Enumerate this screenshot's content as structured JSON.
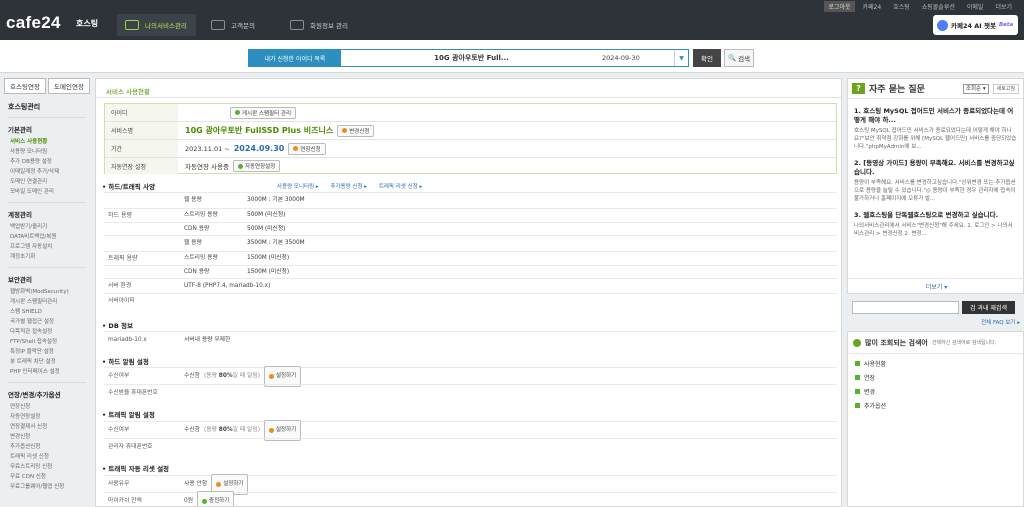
{
  "util": [
    "로그아웃",
    "카페24",
    "호스팅",
    "쇼핑몰솔루션",
    "이메일",
    "더보기"
  ],
  "logo": {
    "brand": "cafe24",
    "sub": "호스팅"
  },
  "nav": [
    {
      "label": "나의서비스관리",
      "active": true
    },
    {
      "label": "고객문의",
      "active": false
    },
    {
      "label": "회원정보 관리",
      "active": false
    }
  ],
  "ai": {
    "label": "카페24 AI 챗봇",
    "beta": "Beta"
  },
  "svc": {
    "label": "내가 신청한 아이디 목록",
    "name": "10G 광아우토반 Full...",
    "date": "2024-09-30",
    "ok": "확인",
    "search": "검색"
  },
  "left": {
    "tabs": [
      "호스팅연장",
      "도메인연장"
    ],
    "title": "호스팅관리",
    "sections": [
      {
        "h": "기본관리",
        "items": [
          "서비스 사용현황",
          "사용량 모니터링",
          "추가 DB용량 설정",
          "이메일계정 추가/삭제",
          "도메인 연결관리",
          "모바일 도메인 관리"
        ],
        "active": 0
      },
      {
        "h": "계정관리",
        "items": [
          "백업받기/올리기",
          "DATA비트백업/복원",
          "프로그램 자동설치",
          "계정초기화"
        ]
      },
      {
        "h": "보안관리",
        "items": [
          "웹방화벽(ModSecurity)",
          "게시판 스팸필터관리",
          "스팸 SHIELD",
          "국가별 웹접근 설정",
          "다목적관 접속설정",
          "FTP/Shell 접속설정",
          "특정IP 블락단 설정",
          "봇 트래픽 차단 설정",
          "PHP 인터페이스 설정"
        ]
      },
      {
        "h": "연장/변경/추가옵션",
        "items": [
          "연장신청",
          "자동연장설정",
          "연장결제서 신청",
          "변경신청",
          "추가옵션신청",
          "트래픽 리셋 신청",
          "무료스트리밍 신청",
          "무료 CDN 신청",
          "무료그룹웨어/웹앱 신청"
        ]
      }
    ]
  },
  "main": {
    "title": "서비스 사용현황",
    "info": {
      "id_label": "아이디",
      "id_btn": "게시판 스팸필터 관리",
      "svc_label": "서비스명",
      "svc_name": "10G 광아우토반 FullSSD Plus 비즈니스",
      "svc_btn": "변경신청",
      "period_label": "기간",
      "period_start": "2023.11.01 ~",
      "period_end": "2024.09.30",
      "period_btn": "연장신청",
      "auto_label": "자동연장 설정",
      "auto_val": "자동연장 사용중",
      "auto_btn": "자동연장설정"
    },
    "usage": {
      "title": "하드/트래픽 사양",
      "links": [
        "사용량 모니터링 ▸",
        "추가용량 신청 ▸",
        "트래픽 리셋 신청 ▸"
      ],
      "hdd_label": "하드 용량",
      "hdd": [
        [
          "웹 용량",
          "3000M : 기본 3000M"
        ],
        [
          "스트리밍 용량",
          "500M (미신청)"
        ],
        [
          "CDN 용량",
          "500M (미신청)"
        ]
      ],
      "traffic_label": "트래픽 용량",
      "traffic": [
        [
          "웹 용량",
          "3500M : 기본 3500M"
        ],
        [
          "스트리밍 용량",
          "1500M (미신청)"
        ],
        [
          "CDN 용량",
          "1500M (미신청)"
        ]
      ],
      "env_label": "서버 환경",
      "env": "UTF-8 (PHP7.4, mariadb-10.x)",
      "ip_label": "서버아이피"
    },
    "db": {
      "title": "DB 정보",
      "k": "mariadb-10.x",
      "v": "서버내 용량 무제한"
    },
    "hdd_alert": {
      "title": "하드 알림 설정",
      "recv_label": "수신여부",
      "recv": "수신함",
      "note_pre": "(용량 ",
      "note_pct": "80%",
      "note_post": "일 때 알림)",
      "btn": "설정하기",
      "phone_label": "수신받을 휴대폰번호"
    },
    "traffic_alert": {
      "title": "트래픽 알림 설정",
      "recv_label": "수신여부",
      "recv": "수신함",
      "note_pre": "(용량 ",
      "note_pct": "80%",
      "note_post": "일 때 알림)",
      "btn": "설정하기",
      "phone_label": "관리자 휴대폰번호"
    },
    "reset": {
      "title": "트래픽 자동 리셋 설정",
      "use_label": "사용유무",
      "use_val": "사용 안함",
      "use_btn": "설정하기",
      "mileage_label": "마이카쉬 잔액",
      "mileage_val": "0원",
      "mileage_btn": "충전하기"
    }
  },
  "faq": {
    "title": "자주 묻는 질문",
    "sort": "조회순 ▾",
    "refresh": "새로고침",
    "items": [
      {
        "t": "1. 호스팅 MySQL 접어드민 서비스가 종료되었다는데 어떻게 해야 하...",
        "d": "호스팅 MySQL 접어드민 서비스가 종료되었다는데 어떻게 해야 하나요?\"보안 취약점 강화를 위해 [MySQL 웹어드민] 서비스를 중단되었습니다.\"phpMyAdmin에 보..."
      },
      {
        "t": "2. [동영상 가이드] 용량이 부족해요. 서비스를 변경하고싶습니다.",
        "d": "용량이 부족해요. 서비스를 변경하고싶습니다.\"상위변경 또는 추가옵션으로 용량을 늘릴 수 있습니다.\"◎ 용량이 부족한 경우 관리자에 접속이 불가하거나 홈페이지에 오류가 발..."
      },
      {
        "t": "3. 웹호스팅을 단독웹호스팅으로 변경하고 싶습니다.",
        "d": "나의서비스관리에서 서비스\"변경신청\"해 주세요. 1. 로그인 > 나의서비스관리 > 변경신청  2. 변경..."
      }
    ],
    "more": "더보기 ▾",
    "search_btn": "검 과내 재검색",
    "all": "전체 FAQ 보기 ▸"
  },
  "popular": {
    "title": "많이 조회되는 검색어",
    "desc": "선택하신 검색어로 검색됩니다.",
    "items": [
      "사용현황",
      "연장",
      "변경",
      "추가옵션"
    ]
  }
}
